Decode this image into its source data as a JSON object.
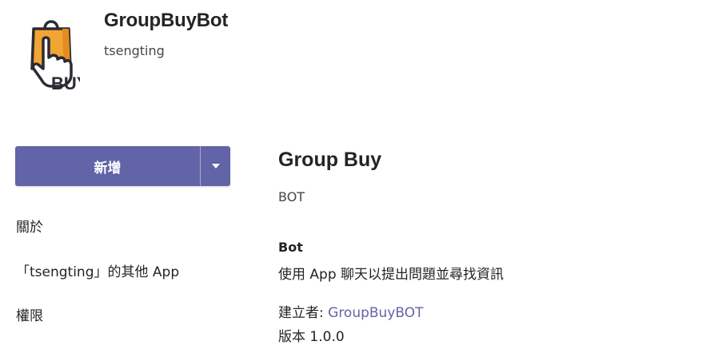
{
  "app": {
    "name": "GroupBuyBot",
    "publisher": "tsengting",
    "logo_text": "BUY"
  },
  "actions": {
    "add_label": "新增"
  },
  "nav": {
    "about": "關於",
    "other_apps": "「tsengting」的其他 App",
    "permissions": "權限"
  },
  "details": {
    "title": "Group Buy",
    "subtitle": "BOT",
    "capability_title": "Bot",
    "capability_desc": "使用 App 聊天以提出問題並尋找資訊",
    "builder_label": "建立者: ",
    "builder_name": "GroupBuyBOT",
    "version": "版本 1.0.0"
  },
  "colors": {
    "accent": "#6264a7",
    "logo_bag": "#f0a534",
    "logo_outline": "#2b2b33"
  }
}
